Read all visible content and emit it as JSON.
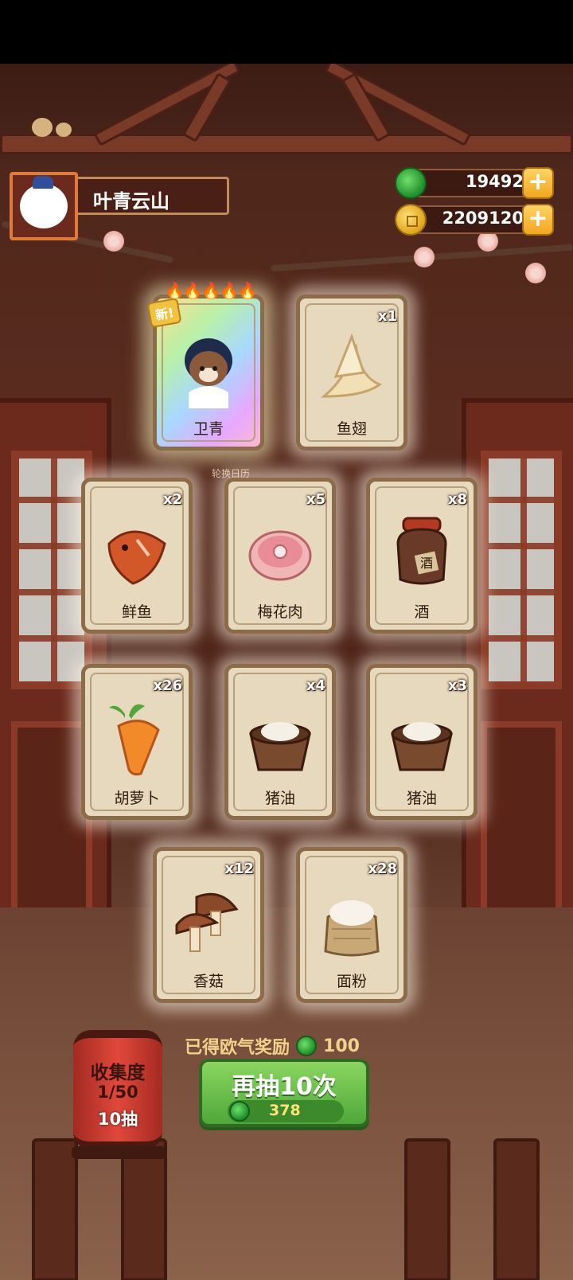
{
  "player": {
    "name": "叶青云山"
  },
  "currency": {
    "jade": {
      "value": "19492",
      "icon": "jade-icon"
    },
    "coin": {
      "value": "2209120",
      "icon": "coin-icon"
    },
    "plus_symbol": "+"
  },
  "hero_card": {
    "label": "卫青",
    "new_tag": "新!",
    "flames": "🔥🔥🔥🔥🔥",
    "caption": "轮换日历"
  },
  "cards": [
    {
      "label": "鱼翅",
      "qty": "x1",
      "icon": "shark-fin-icon"
    },
    {
      "label": "鲜鱼",
      "qty": "x2",
      "icon": "fish-icon"
    },
    {
      "label": "梅花肉",
      "qty": "x5",
      "icon": "pork-icon"
    },
    {
      "label": "酒",
      "qty": "x8",
      "icon": "wine-jar-icon",
      "jar_text": "酒"
    },
    {
      "label": "胡萝卜",
      "qty": "x26",
      "icon": "carrot-icon"
    },
    {
      "label": "猪油",
      "qty": "x4",
      "icon": "lard-icon"
    },
    {
      "label": "猪油",
      "qty": "x3",
      "icon": "lard-icon"
    },
    {
      "label": "香菇",
      "qty": "x12",
      "icon": "mushroom-icon"
    },
    {
      "label": "面粉",
      "qty": "x28",
      "icon": "flour-sack-icon"
    }
  ],
  "reward": {
    "label": "已得欧气奖励",
    "value": "100"
  },
  "redraw": {
    "label": "再抽10次",
    "cost": "378"
  },
  "collection": {
    "title": "收集度",
    "progress": "1/50",
    "draws": "10抽"
  },
  "colors": {
    "accent_green": "#4ea83a",
    "card_bg": "#e7d9bd",
    "gold": "#f1a621"
  }
}
